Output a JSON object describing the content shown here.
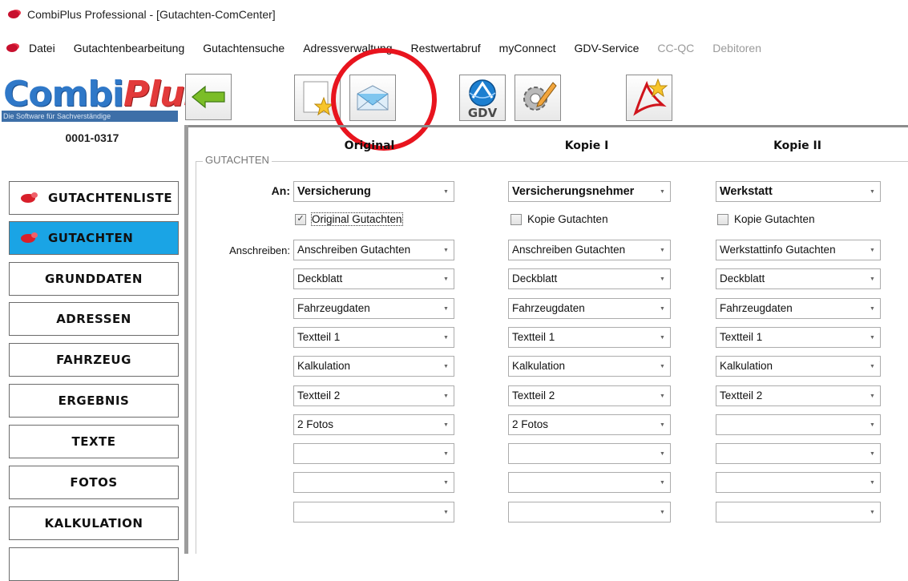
{
  "window": {
    "title": "CombiPlus Professional - [Gutachten-ComCenter]"
  },
  "menu": [
    {
      "label": "Datei",
      "enabled": true
    },
    {
      "label": "Gutachtenbearbeitung",
      "enabled": true
    },
    {
      "label": "Gutachtensuche",
      "enabled": true
    },
    {
      "label": "Adressverwaltung",
      "enabled": true
    },
    {
      "label": "Restwertabruf",
      "enabled": true
    },
    {
      "label": "myConnect",
      "enabled": true
    },
    {
      "label": "GDV-Service",
      "enabled": true
    },
    {
      "label": "CC-QC",
      "enabled": false
    },
    {
      "label": "Debitoren",
      "enabled": false
    }
  ],
  "logo": {
    "part1": "Combi",
    "part2": "Plus",
    "tagline": "Die Software für Sachverständige"
  },
  "toolbar": {
    "gdv_label": "GDV"
  },
  "case_id": "0001-0317",
  "nav": [
    {
      "label": "GUTACHTENLISTE",
      "icon": "car-icon",
      "active": false
    },
    {
      "label": "GUTACHTEN",
      "icon": "car-icon",
      "active": true
    },
    {
      "label": "GRUNDDATEN",
      "icon": null,
      "active": false
    },
    {
      "label": "ADRESSEN",
      "icon": null,
      "active": false
    },
    {
      "label": "FAHRZEUG",
      "icon": null,
      "active": false
    },
    {
      "label": "ERGEBNIS",
      "icon": null,
      "active": false
    },
    {
      "label": "TEXTE",
      "icon": null,
      "active": false
    },
    {
      "label": "FOTOS",
      "icon": null,
      "active": false
    },
    {
      "label": "KALKULATION",
      "icon": null,
      "active": false
    }
  ],
  "colors": {
    "nav_active": "#1aa4e5",
    "highlight_circle": "#e8141e"
  },
  "group": {
    "title": "GUTACHTEN",
    "label_an": "An:",
    "label_anschreiben": "Anschreiben:",
    "columns": [
      {
        "header": "Original",
        "recipient": "Versicherung",
        "checkbox": {
          "label": "Original Gutachten",
          "checked": true
        },
        "items": [
          "Anschreiben Gutachten",
          "Deckblatt",
          "Fahrzeugdaten",
          "Textteil 1",
          "Kalkulation",
          "Textteil 2",
          "2 Fotos",
          "",
          "",
          ""
        ]
      },
      {
        "header": "Kopie I",
        "recipient": "Versicherungsnehmer",
        "checkbox": {
          "label": "Kopie Gutachten",
          "checked": false
        },
        "items": [
          "Anschreiben Gutachten",
          "Deckblatt",
          "Fahrzeugdaten",
          "Textteil 1",
          "Kalkulation",
          "Textteil 2",
          "2 Fotos",
          "",
          "",
          ""
        ]
      },
      {
        "header": "Kopie II",
        "recipient": "Werkstatt",
        "checkbox": {
          "label": "Kopie Gutachten",
          "checked": false
        },
        "items": [
          "Werkstattinfo Gutachten",
          "Deckblatt",
          "Fahrzeugdaten",
          "Textteil 1",
          "Kalkulation",
          "Textteil 2",
          "",
          "",
          "",
          ""
        ]
      }
    ]
  }
}
